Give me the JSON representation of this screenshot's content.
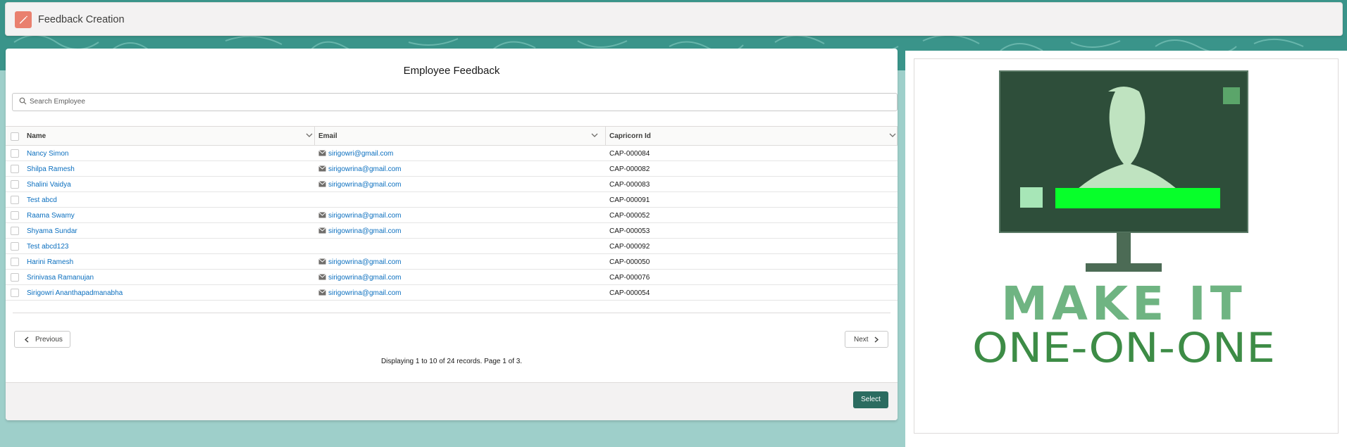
{
  "header": {
    "title": "Feedback Creation",
    "icon": "pencil-icon",
    "icon_color": "#e9806e"
  },
  "card": {
    "title": "Employee Feedback",
    "search_placeholder": "Search Employee"
  },
  "table": {
    "columns": [
      "Name",
      "Email",
      "Capricorn Id"
    ],
    "rows": [
      {
        "name": "Nancy Simon",
        "email": "sirigowri@gmail.com",
        "id": "CAP-000084"
      },
      {
        "name": "Shilpa Ramesh",
        "email": "sirigowrina@gmail.com",
        "id": "CAP-000082"
      },
      {
        "name": "Shalini Vaidya",
        "email": "sirigowrina@gmail.com",
        "id": "CAP-000083"
      },
      {
        "name": "Test abcd",
        "email": "",
        "id": "CAP-000091"
      },
      {
        "name": "Raama Swamy",
        "email": "sirigowrina@gmail.com",
        "id": "CAP-000052"
      },
      {
        "name": "Shyama Sundar",
        "email": "sirigowrina@gmail.com",
        "id": "CAP-000053"
      },
      {
        "name": "Test abcd123",
        "email": "",
        "id": "CAP-000092"
      },
      {
        "name": "Harini Ramesh",
        "email": "sirigowrina@gmail.com",
        "id": "CAP-000050"
      },
      {
        "name": "Srinivasa Ramanujan",
        "email": "sirigowrina@gmail.com",
        "id": "CAP-000076"
      },
      {
        "name": "Sirigowri Ananthapadmanabha",
        "email": "sirigowrina@gmail.com",
        "id": "CAP-000054"
      }
    ]
  },
  "pagination": {
    "previous_label": "Previous",
    "next_label": "Next",
    "records_text": "Displaying 1 to 10 of 24 records. Page 1 of 3."
  },
  "footer": {
    "select_label": "Select"
  },
  "logo": {
    "line1": "MAKE IT",
    "line2": "ONE-ON-ONE",
    "colors": {
      "screen": "#2e4e3a",
      "text_light": "#6fb482",
      "text_dark": "#3d8c46",
      "bar": "#07ff2a"
    }
  },
  "colors": {
    "link": "#0b6fbf",
    "brand_button": "#2b6c60",
    "background": "#9ecfca"
  }
}
